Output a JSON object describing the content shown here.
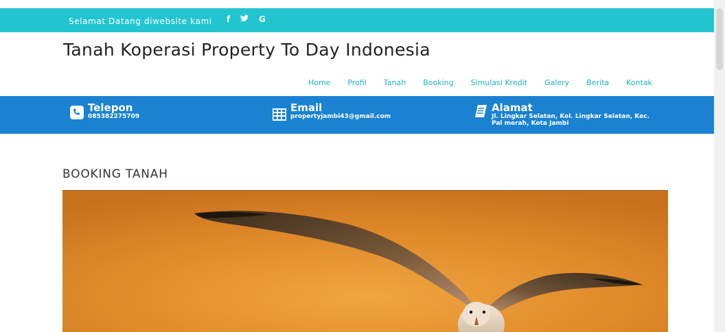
{
  "topbar": {
    "welcome": "Selamat Datang diwebsite kami",
    "social": [
      {
        "icon": "facebook-icon",
        "glyph": "f"
      },
      {
        "icon": "twitter-icon",
        "glyph": "♥"
      },
      {
        "icon": "google-icon",
        "glyph": "G"
      }
    ],
    "bg_color": "#22c5cf"
  },
  "site": {
    "title": "Tanah Koperasi Property To Day Indonesia"
  },
  "nav": {
    "items": [
      "Home",
      "Profil",
      "Tanah",
      "Booking",
      "Simulasi Kredit",
      "Galery",
      "Berita",
      "Kontak"
    ],
    "color": "#1bb3c6"
  },
  "contact": {
    "bg_color": "#1b82d2",
    "phone": {
      "icon": "phone-icon",
      "title": "Telepon",
      "value": "085382275709"
    },
    "email": {
      "icon": "email-icon",
      "title": "Email",
      "value": "propertyjambi43@gmail.com"
    },
    "address": {
      "icon": "book-icon",
      "title": "Alamat",
      "line1": "Jl. Lingkar Selatan, Kel. Lingkar Selatan, Kec.",
      "line2": "Pal merah, Kota Jambi"
    }
  },
  "main": {
    "heading": "BOOKING TANAH",
    "hero_image": "seagull-flying-orange-sky"
  }
}
